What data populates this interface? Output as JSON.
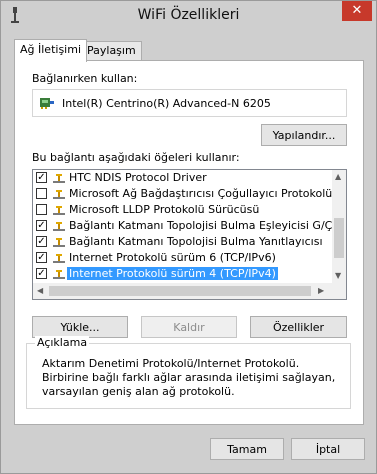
{
  "window": {
    "title": "WiFi Özellikleri",
    "close_label": "✕"
  },
  "tabs": [
    {
      "label": "Ağ İletişimi"
    },
    {
      "label": "Paylaşım"
    }
  ],
  "connect_using": {
    "label": "Bağlanırken kullan:",
    "adapter": "Intel(R) Centrino(R) Advanced-N 6205",
    "configure_label": "Yapılandır..."
  },
  "items_label": "Bu bağlantı aşağıdaki öğeleri kullanır:",
  "items": [
    {
      "label": "HTC NDIS Protocol Driver",
      "checked": true,
      "check": "✓"
    },
    {
      "label": "Microsoft Ağ Bağdaştırıcısı Çoğullayıcı Protokolü",
      "checked": false,
      "check": ""
    },
    {
      "label": "Microsoft LLDP Protokolü Sürücüsü",
      "checked": false,
      "check": ""
    },
    {
      "label": "Bağlantı Katmanı Topolojisi Bulma Eşleyicisi G/Ç Sürücü",
      "checked": true,
      "check": "✓"
    },
    {
      "label": "Bağlantı Katmanı Topolojisi Bulma Yanıtlayıcısı",
      "checked": true,
      "check": "✓"
    },
    {
      "label": "Internet Protokolü sürüm 6 (TCP/IPv6)",
      "checked": true,
      "check": "✓"
    },
    {
      "label": "Internet Protokolü sürüm 4 (TCP/IPv4)",
      "checked": true,
      "check": "✓",
      "selected": true
    }
  ],
  "buttons": {
    "install": "Yükle...",
    "uninstall": "Kaldır",
    "properties": "Özellikler",
    "ok": "Tamam",
    "cancel": "İptal"
  },
  "description": {
    "title": "Açıklama",
    "text": "Aktarım Denetimi Protokolü/Internet Protokolü. Birbirine bağlı farklı ağlar arasında iletişimi sağlayan, varsayılan geniş alan ağ protokolü."
  },
  "colors": {
    "selection": "#3399ff",
    "close_button": "#c7392b"
  }
}
